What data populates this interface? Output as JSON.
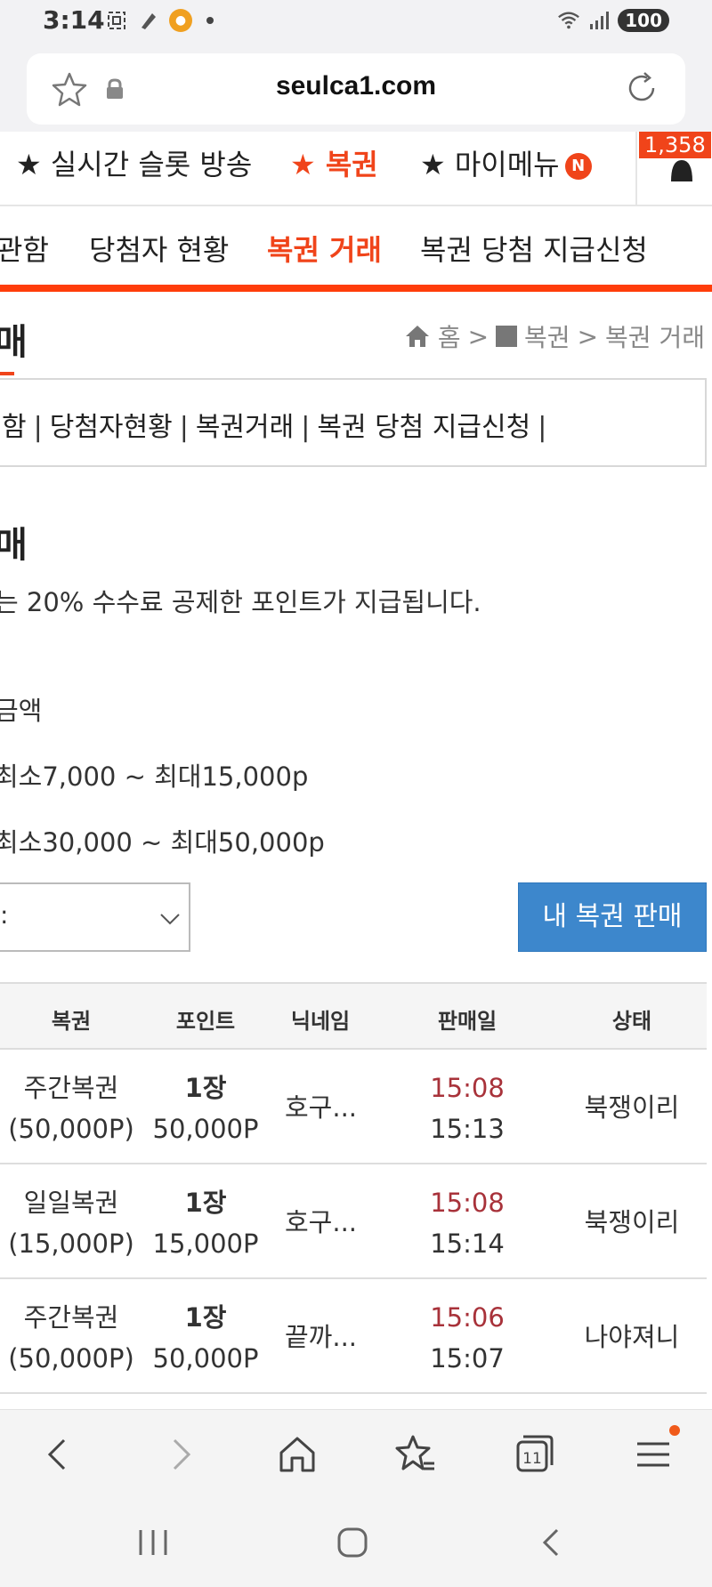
{
  "status_bar": {
    "time": "3:14",
    "battery": "100",
    "icons_left": [
      "screenshot-icon",
      "pen-icon",
      "app-icon"
    ],
    "icons_right": [
      "wifi-icon",
      "signal-icon",
      "battery-icon"
    ]
  },
  "browser": {
    "url": "seulca1.com"
  },
  "top_nav": {
    "items": [
      {
        "label": "★ 실시간 슬롯 방송"
      },
      {
        "label": "★ 복권"
      },
      {
        "label": "★ 마이메뉴"
      }
    ],
    "new_badge": "N",
    "notification_count": "1,358"
  },
  "sub_nav": {
    "items": [
      {
        "label": "관함"
      },
      {
        "label": "당첨자 현황"
      },
      {
        "label": "복권 거래"
      },
      {
        "label": "복권 당첨 지급신청"
      }
    ]
  },
  "page": {
    "title_fragment": "매",
    "breadcrumb": {
      "home": "홈",
      "sep1": ">",
      "level1": "복권",
      "sep2": ">",
      "level2": "복권 거래"
    },
    "tab_links": {
      "l0": "함",
      "l1": "당첨자현황",
      "l2": "복권거래",
      "l3": "복권 당첨 지급신청",
      "sep": "|"
    },
    "section_title": "매",
    "description": "는 20% 수수료 공제한 포인트가 지급됩니다.",
    "amount_label": "금액",
    "range_daily": "최소7,000 ~ 최대15,000p",
    "range_weekly": "최소30,000 ~ 최대50,000p",
    "select_value": ":",
    "sell_button": "내 복권 판매"
  },
  "table": {
    "headers": {
      "lottery": "복권",
      "points": "포인트",
      "nickname": "닉네임",
      "date": "판매일",
      "status": "상태"
    },
    "rows": [
      {
        "name": "주간복권",
        "price": "(50,000P)",
        "qty": "1장",
        "points": "50,000P",
        "nickname": "호구...",
        "date1": "15:08",
        "date2": "15:13",
        "status": "북쟁이리"
      },
      {
        "name": "일일복권",
        "price": "(15,000P)",
        "qty": "1장",
        "points": "15,000P",
        "nickname": "호구...",
        "date1": "15:08",
        "date2": "15:14",
        "status": "북쟁이리"
      },
      {
        "name": "주간복권",
        "price": "(50,000P)",
        "qty": "1장",
        "points": "50,000P",
        "nickname": "끝까...",
        "date1": "15:06",
        "date2": "15:07",
        "status": "나야져니"
      }
    ]
  },
  "browser_bar": {
    "tab_count": "11",
    "icons": [
      "back-icon",
      "forward-icon",
      "home-icon",
      "bookmarks-icon",
      "tabs-icon",
      "menu-icon"
    ]
  },
  "system_nav": {
    "icons": [
      "recents-icon",
      "home-button-icon",
      "back-nav-icon"
    ]
  },
  "colors": {
    "accent": "#f0441a",
    "button_blue": "#3d87cc",
    "date_red": "#a8323a"
  }
}
